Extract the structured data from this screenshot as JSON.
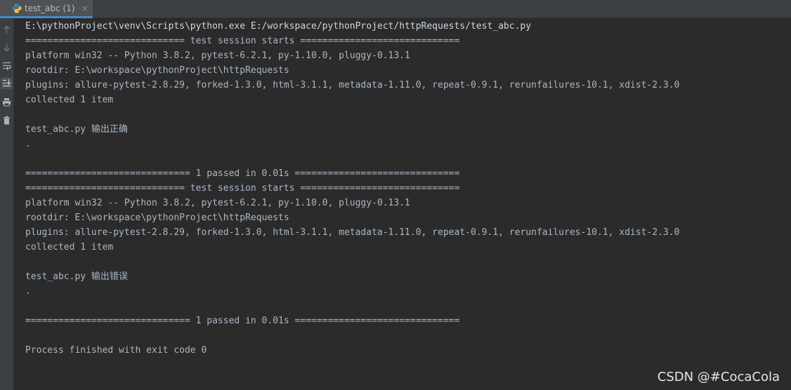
{
  "tab": {
    "title": "test_abc (1)",
    "close": "×",
    "icon": "python-file-icon"
  },
  "toolbar": {
    "buttons": [
      {
        "name": "up-arrow-icon"
      },
      {
        "name": "down-arrow-icon"
      },
      {
        "name": "soft-wrap-icon"
      },
      {
        "name": "scroll-to-end-icon"
      },
      {
        "name": "print-icon"
      },
      {
        "name": "trash-icon"
      }
    ]
  },
  "console": {
    "lines": [
      "E:\\pythonProject\\venv\\Scripts\\python.exe E:/workspace/pythonProject/httpRequests/test_abc.py",
      "============================= test session starts =============================",
      "platform win32 -- Python 3.8.2, pytest-6.2.1, py-1.10.0, pluggy-0.13.1",
      "rootdir: E:\\workspace\\pythonProject\\httpRequests",
      "plugins: allure-pytest-2.8.29, forked-1.3.0, html-3.1.1, metadata-1.11.0, repeat-0.9.1, rerunfailures-10.1, xdist-2.3.0",
      "collected 1 item",
      "",
      "test_abc.py 输出正确",
      ".",
      "",
      "============================== 1 passed in 0.01s ==============================",
      "============================= test session starts =============================",
      "platform win32 -- Python 3.8.2, pytest-6.2.1, py-1.10.0, pluggy-0.13.1",
      "rootdir: E:\\workspace\\pythonProject\\httpRequests",
      "plugins: allure-pytest-2.8.29, forked-1.3.0, html-3.1.1, metadata-1.11.0, repeat-0.9.1, rerunfailures-10.1, xdist-2.3.0",
      "collected 1 item",
      "",
      "test_abc.py 输出错误",
      ".",
      "",
      "============================== 1 passed in 0.01s ==============================",
      "",
      "Process finished with exit code 0"
    ]
  },
  "watermark": "CSDN @#CocaCola",
  "colors": {
    "background": "#2b2b2b",
    "text": "#a9b7c6",
    "tab_accent": "#4a88c7"
  }
}
